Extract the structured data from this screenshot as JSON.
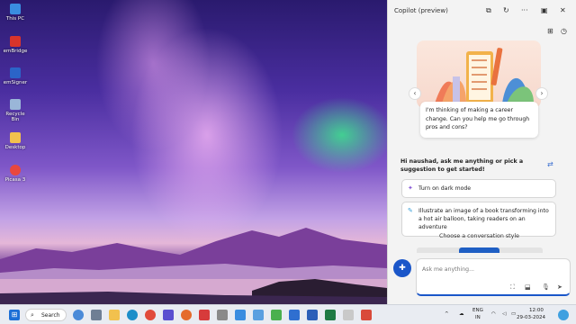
{
  "desktop": {
    "icons": [
      {
        "label": "This PC",
        "icon": "computer-icon",
        "color": "#3a8de0"
      },
      {
        "label": "emBridge",
        "icon": "embridge-icon",
        "color": "#d9342b"
      },
      {
        "label": "emSigner",
        "icon": "emsigner-icon",
        "color": "#2b64c8"
      },
      {
        "label": "Recycle Bin",
        "icon": "recycle-bin-icon",
        "color": "#9ab6d8"
      },
      {
        "label": "Desktop",
        "icon": "folder-icon",
        "color": "#f2c14e"
      },
      {
        "label": "Picasa 3",
        "icon": "picasa-icon",
        "color": "#e9473d"
      }
    ]
  },
  "copilot": {
    "title": "Copilot (preview)",
    "header_icons": [
      "open-new-icon",
      "refresh-icon",
      "more-icon",
      "sidebar-icon",
      "close-icon"
    ],
    "prompt_card": "I'm thinking of making a career change. Can you help me go through pros and cons?",
    "greeting": "Hi naushad, ask me anything or pick a suggestion to get started!",
    "suggestions": [
      {
        "text": "Turn on dark mode",
        "icon": "sparkle-icon"
      },
      {
        "text": "Illustrate an image of a book transforming into a hot air balloon, taking readers on an adventure",
        "icon": "paint-icon"
      }
    ],
    "style_label": "Choose a conversation style",
    "input_placeholder": "Ask me anything...",
    "accent": "#1a56c9"
  },
  "taskbar": {
    "search_label": "Search",
    "language": "ENG",
    "region": "IN",
    "time": "12:00",
    "date": "29-03-2024"
  }
}
